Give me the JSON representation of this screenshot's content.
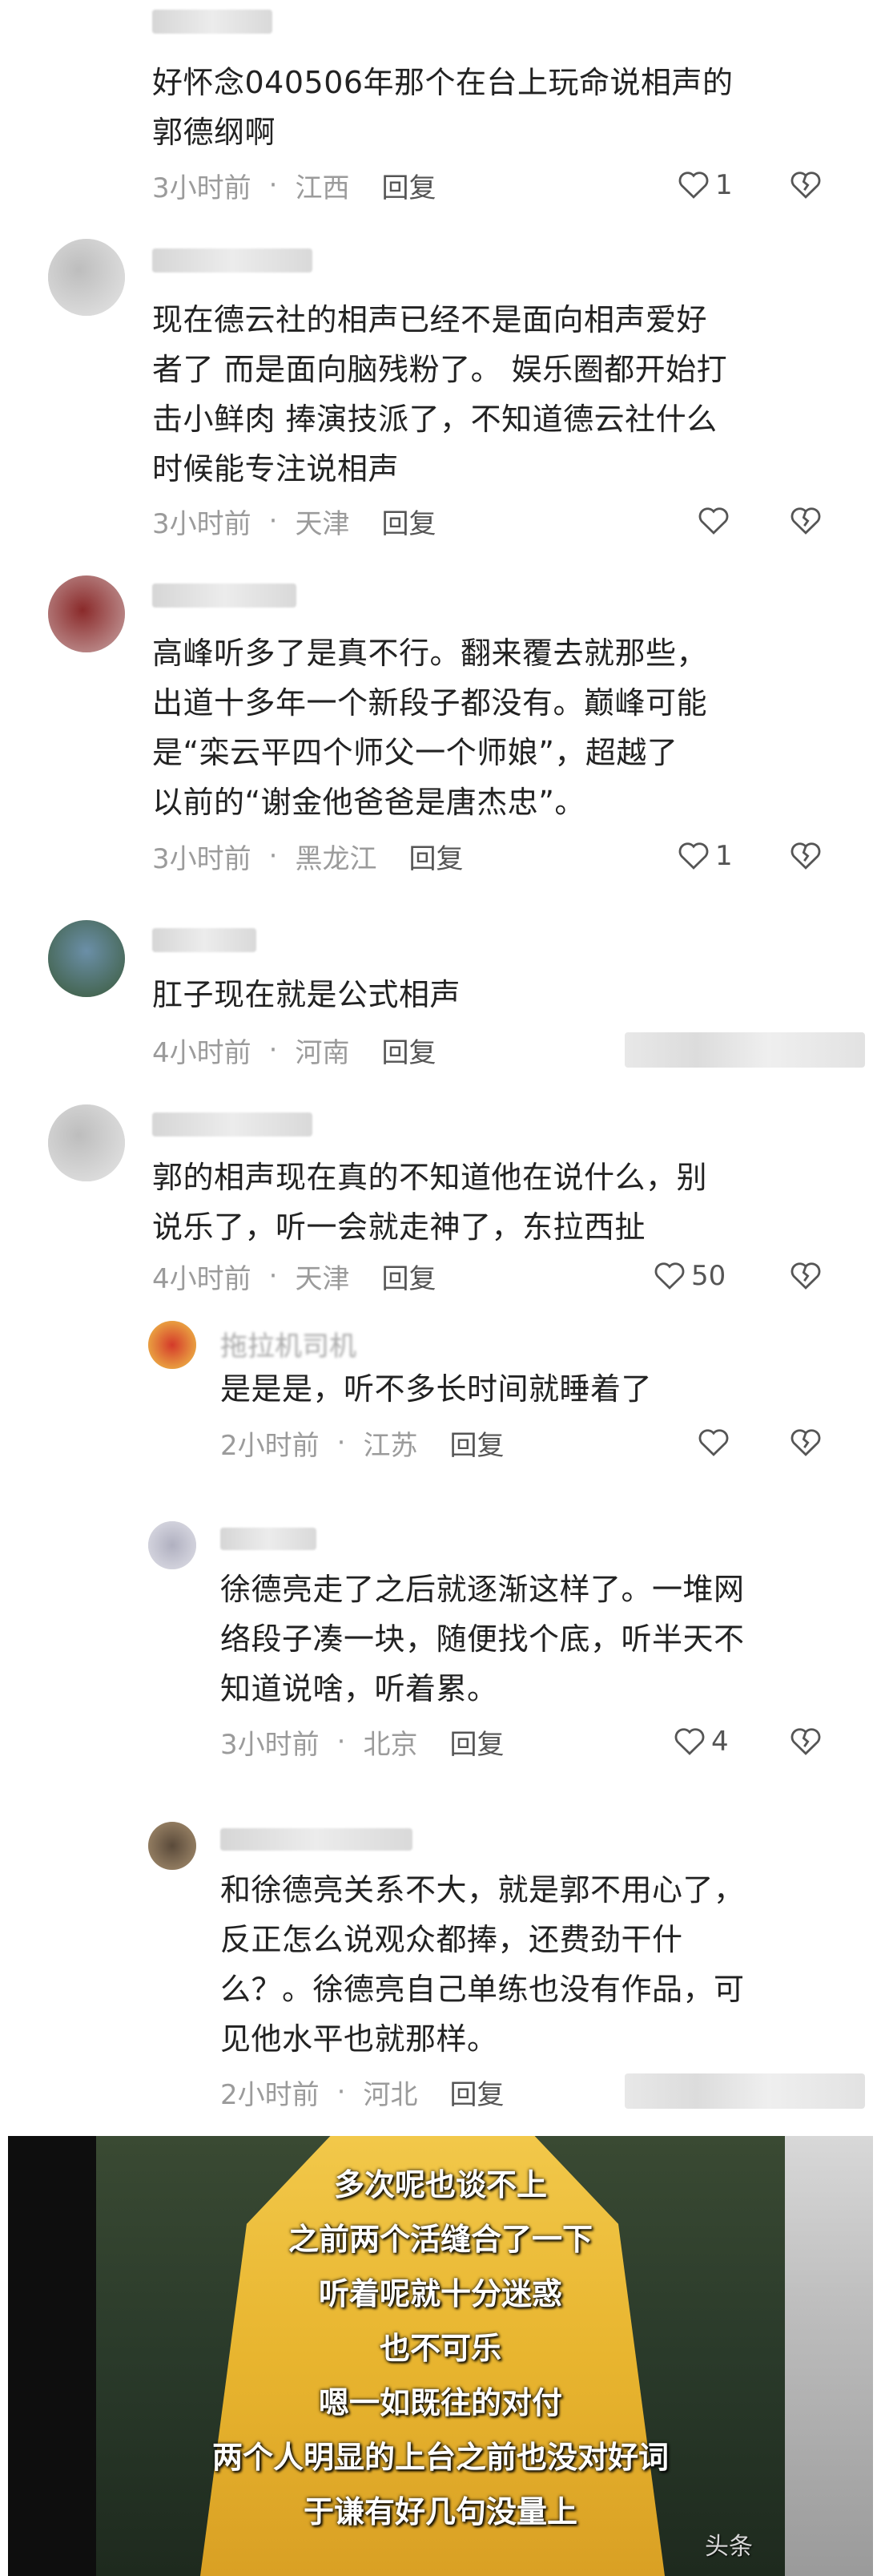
{
  "comments": [
    {
      "text_lines": [
        "好怀念040506年那个在台上玩命说相声的",
        "郭德纲啊"
      ],
      "time": "3小时前",
      "location": "江西",
      "reply": "回复",
      "likes": "1"
    },
    {
      "text_lines": [
        "现在德云社的相声已经不是面向相声爱好",
        "者了 而是面向脑残粉了。 娱乐圈都开始打",
        "击小鲜肉 捧演技派了，不知道德云社什么",
        "时候能专注说相声"
      ],
      "time": "3小时前",
      "location": "天津",
      "reply": "回复",
      "likes": ""
    },
    {
      "text_lines": [
        "高峰听多了是真不行。翻来覆去就那些，",
        "出道十多年一个新段子都没有。巅峰可能",
        "是“栾云平四个师父一个师娘”，超越了",
        "以前的“谢金他爸爸是唐杰忠”。"
      ],
      "time": "3小时前",
      "location": "黑龙江",
      "reply": "回复",
      "likes": "1"
    },
    {
      "text_lines": [
        "肛子现在就是公式相声"
      ],
      "time": "4小时前",
      "location": "河南",
      "reply": "回复",
      "likes": ""
    },
    {
      "text_lines": [
        "郭的相声现在真的不知道他在说什么，别",
        "说乐了，听一会就走神了，东拉西扯"
      ],
      "time": "4小时前",
      "location": "天津",
      "reply": "回复",
      "likes": "50"
    },
    {
      "username": "拖拉机司机",
      "text_lines": [
        "是是是，听不多长时间就睡着了"
      ],
      "time": "2小时前",
      "location": "江苏",
      "reply": "回复",
      "likes": ""
    },
    {
      "text_lines": [
        "徐德亮走了之后就逐渐这样了。一堆网",
        "络段子凑一块，随便找个底，听半天不",
        "知道说啥，听着累。"
      ],
      "time": "3小时前",
      "location": "北京",
      "reply": "回复",
      "likes": "4"
    },
    {
      "text_lines": [
        "和徐德亮关系不大，就是郭不用心了，",
        "反正怎么说观众都捧，还费劲干什",
        "么？。徐德亮自己单练也没有作品，可",
        "见他水平也就那样。"
      ],
      "time": "2小时前",
      "location": "河北",
      "reply": "回复",
      "likes": ""
    }
  ],
  "video": {
    "subtitles": [
      "多次呢也谈不上",
      "之前两个活缝合了一下",
      "听着呢就十分迷惑",
      "也不可乐",
      "嗯一如既往的对付",
      "两个人明显的上台之前也没对好词",
      "于谦有好几句没量上"
    ],
    "watermark": "头条"
  },
  "icons": {
    "like": "heart-icon",
    "dislike": "broken-heart-icon"
  },
  "colors": {
    "meta_gray": "#9b9b9b",
    "text": "#222222"
  }
}
